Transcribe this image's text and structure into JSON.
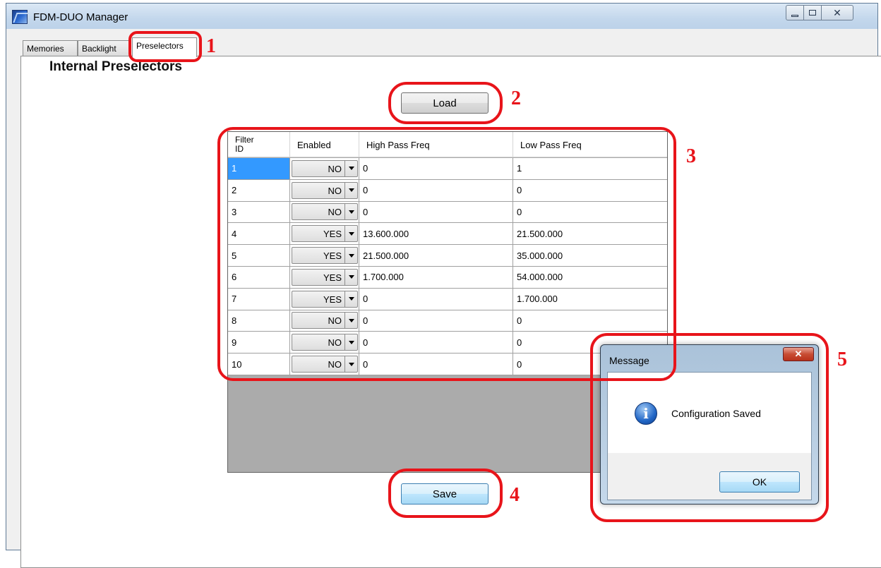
{
  "window": {
    "title": "FDM-DUO Manager",
    "buttons": {
      "minimize": "minimize-icon",
      "maximize": "maximize-icon",
      "close": "close-icon"
    }
  },
  "tabs": [
    {
      "label": "Memories",
      "selected": false
    },
    {
      "label": "Backlight",
      "selected": false
    },
    {
      "label": "Preselectors",
      "selected": true
    }
  ],
  "panel": {
    "section_title": "Internal Preselectors",
    "load_label": "Load",
    "save_label": "Save"
  },
  "grid": {
    "columns": [
      "Filter ID",
      "Enabled",
      "High Pass Freq",
      "Low Pass Freq"
    ],
    "rows": [
      {
        "id": "1",
        "enabled": "NO",
        "high_pass": "0",
        "low_pass": "1"
      },
      {
        "id": "2",
        "enabled": "NO",
        "high_pass": "0",
        "low_pass": "0"
      },
      {
        "id": "3",
        "enabled": "NO",
        "high_pass": "0",
        "low_pass": "0"
      },
      {
        "id": "4",
        "enabled": "YES",
        "high_pass": "13.600.000",
        "low_pass": "21.500.000"
      },
      {
        "id": "5",
        "enabled": "YES",
        "high_pass": "21.500.000",
        "low_pass": "35.000.000"
      },
      {
        "id": "6",
        "enabled": "YES",
        "high_pass": "1.700.000",
        "low_pass": "54.000.000"
      },
      {
        "id": "7",
        "enabled": "YES",
        "high_pass": "0",
        "low_pass": "1.700.000"
      },
      {
        "id": "8",
        "enabled": "NO",
        "high_pass": "0",
        "low_pass": "0"
      },
      {
        "id": "9",
        "enabled": "NO",
        "high_pass": "0",
        "low_pass": "0"
      },
      {
        "id": "10",
        "enabled": "NO",
        "high_pass": "0",
        "low_pass": "0"
      }
    ],
    "selected_row": 0
  },
  "dialog": {
    "title": "Message",
    "message": "Configuration Saved",
    "ok_label": "OK",
    "icon": "info-icon"
  },
  "annotations": {
    "color": "#e8141a",
    "marks": [
      "1",
      "2",
      "3",
      "4",
      "5"
    ]
  }
}
